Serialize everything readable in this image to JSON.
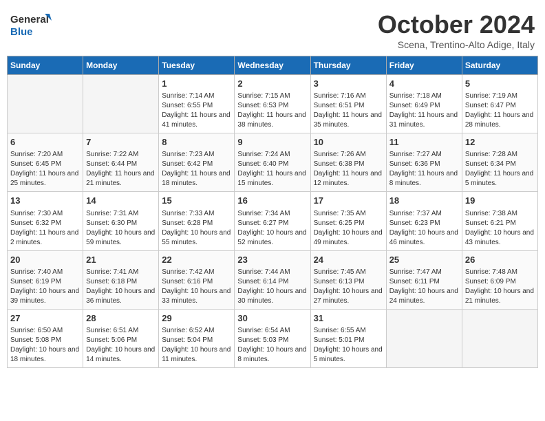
{
  "header": {
    "logo_line1": "General",
    "logo_line2": "Blue",
    "month": "October 2024",
    "location": "Scena, Trentino-Alto Adige, Italy"
  },
  "days_of_week": [
    "Sunday",
    "Monday",
    "Tuesday",
    "Wednesday",
    "Thursday",
    "Friday",
    "Saturday"
  ],
  "weeks": [
    [
      {
        "day": "",
        "info": ""
      },
      {
        "day": "",
        "info": ""
      },
      {
        "day": "1",
        "info": "Sunrise: 7:14 AM\nSunset: 6:55 PM\nDaylight: 11 hours and 41 minutes."
      },
      {
        "day": "2",
        "info": "Sunrise: 7:15 AM\nSunset: 6:53 PM\nDaylight: 11 hours and 38 minutes."
      },
      {
        "day": "3",
        "info": "Sunrise: 7:16 AM\nSunset: 6:51 PM\nDaylight: 11 hours and 35 minutes."
      },
      {
        "day": "4",
        "info": "Sunrise: 7:18 AM\nSunset: 6:49 PM\nDaylight: 11 hours and 31 minutes."
      },
      {
        "day": "5",
        "info": "Sunrise: 7:19 AM\nSunset: 6:47 PM\nDaylight: 11 hours and 28 minutes."
      }
    ],
    [
      {
        "day": "6",
        "info": "Sunrise: 7:20 AM\nSunset: 6:45 PM\nDaylight: 11 hours and 25 minutes."
      },
      {
        "day": "7",
        "info": "Sunrise: 7:22 AM\nSunset: 6:44 PM\nDaylight: 11 hours and 21 minutes."
      },
      {
        "day": "8",
        "info": "Sunrise: 7:23 AM\nSunset: 6:42 PM\nDaylight: 11 hours and 18 minutes."
      },
      {
        "day": "9",
        "info": "Sunrise: 7:24 AM\nSunset: 6:40 PM\nDaylight: 11 hours and 15 minutes."
      },
      {
        "day": "10",
        "info": "Sunrise: 7:26 AM\nSunset: 6:38 PM\nDaylight: 11 hours and 12 minutes."
      },
      {
        "day": "11",
        "info": "Sunrise: 7:27 AM\nSunset: 6:36 PM\nDaylight: 11 hours and 8 minutes."
      },
      {
        "day": "12",
        "info": "Sunrise: 7:28 AM\nSunset: 6:34 PM\nDaylight: 11 hours and 5 minutes."
      }
    ],
    [
      {
        "day": "13",
        "info": "Sunrise: 7:30 AM\nSunset: 6:32 PM\nDaylight: 11 hours and 2 minutes."
      },
      {
        "day": "14",
        "info": "Sunrise: 7:31 AM\nSunset: 6:30 PM\nDaylight: 10 hours and 59 minutes."
      },
      {
        "day": "15",
        "info": "Sunrise: 7:33 AM\nSunset: 6:28 PM\nDaylight: 10 hours and 55 minutes."
      },
      {
        "day": "16",
        "info": "Sunrise: 7:34 AM\nSunset: 6:27 PM\nDaylight: 10 hours and 52 minutes."
      },
      {
        "day": "17",
        "info": "Sunrise: 7:35 AM\nSunset: 6:25 PM\nDaylight: 10 hours and 49 minutes."
      },
      {
        "day": "18",
        "info": "Sunrise: 7:37 AM\nSunset: 6:23 PM\nDaylight: 10 hours and 46 minutes."
      },
      {
        "day": "19",
        "info": "Sunrise: 7:38 AM\nSunset: 6:21 PM\nDaylight: 10 hours and 43 minutes."
      }
    ],
    [
      {
        "day": "20",
        "info": "Sunrise: 7:40 AM\nSunset: 6:19 PM\nDaylight: 10 hours and 39 minutes."
      },
      {
        "day": "21",
        "info": "Sunrise: 7:41 AM\nSunset: 6:18 PM\nDaylight: 10 hours and 36 minutes."
      },
      {
        "day": "22",
        "info": "Sunrise: 7:42 AM\nSunset: 6:16 PM\nDaylight: 10 hours and 33 minutes."
      },
      {
        "day": "23",
        "info": "Sunrise: 7:44 AM\nSunset: 6:14 PM\nDaylight: 10 hours and 30 minutes."
      },
      {
        "day": "24",
        "info": "Sunrise: 7:45 AM\nSunset: 6:13 PM\nDaylight: 10 hours and 27 minutes."
      },
      {
        "day": "25",
        "info": "Sunrise: 7:47 AM\nSunset: 6:11 PM\nDaylight: 10 hours and 24 minutes."
      },
      {
        "day": "26",
        "info": "Sunrise: 7:48 AM\nSunset: 6:09 PM\nDaylight: 10 hours and 21 minutes."
      }
    ],
    [
      {
        "day": "27",
        "info": "Sunrise: 6:50 AM\nSunset: 5:08 PM\nDaylight: 10 hours and 18 minutes."
      },
      {
        "day": "28",
        "info": "Sunrise: 6:51 AM\nSunset: 5:06 PM\nDaylight: 10 hours and 14 minutes."
      },
      {
        "day": "29",
        "info": "Sunrise: 6:52 AM\nSunset: 5:04 PM\nDaylight: 10 hours and 11 minutes."
      },
      {
        "day": "30",
        "info": "Sunrise: 6:54 AM\nSunset: 5:03 PM\nDaylight: 10 hours and 8 minutes."
      },
      {
        "day": "31",
        "info": "Sunrise: 6:55 AM\nSunset: 5:01 PM\nDaylight: 10 hours and 5 minutes."
      },
      {
        "day": "",
        "info": ""
      },
      {
        "day": "",
        "info": ""
      }
    ]
  ]
}
